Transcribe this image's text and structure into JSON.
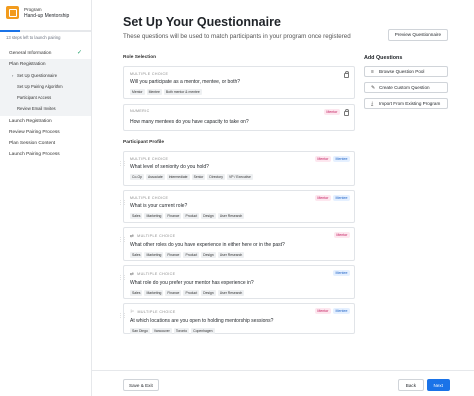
{
  "brand": {
    "program_label": "Program",
    "program_name": "Hand-up Mentorship"
  },
  "progress": {
    "fraction": 0.22,
    "steps_left": "13 steps left to launch pairing"
  },
  "sidebar": {
    "general_information": "General Information",
    "plan_registration": "Plan Registration",
    "sub_items": [
      "Set Up Questionnaire",
      "Set Up Pairing Algorithm",
      "Participant Access",
      "Review Email Invites"
    ],
    "launch_registration": "Launch Registration",
    "review_pairing_process": "Review Pairing Process",
    "plan_session_content": "Plan Session Content",
    "launch_pairing_process": "Launch Pairing Process"
  },
  "header": {
    "title": "Set Up Your Questionnaire",
    "subtitle": "These questions will be used to match participants in your program once registered",
    "preview_button": "Preview Questionnaire"
  },
  "role_selection": {
    "label": "Role Selection",
    "q1": {
      "type": "Multiple Choice",
      "question": "Will you participate as a mentor, mentee, or both?",
      "options": [
        "Mentor",
        "Mentee",
        "Both mentor & mentee"
      ]
    },
    "q2": {
      "type": "Numeric",
      "question": "How many mentees do you have capacity to take on?",
      "tags": [
        "Mentor"
      ]
    }
  },
  "participant_profile": {
    "label": "Participant Profile",
    "q1": {
      "type": "Multiple Choice",
      "question": "What level of seniority do you hold?",
      "tags": [
        "Mentor",
        "Mentee"
      ],
      "options": [
        "Co-Op",
        "Associate",
        "Intermediate",
        "Senior",
        "Directory",
        "VP / Executive"
      ]
    },
    "q2": {
      "type": "Multiple Choice",
      "question": "What is your current role?",
      "tags": [
        "Mentor",
        "Mentee"
      ],
      "options": [
        "Sales",
        "Marketing",
        "Finance",
        "Product",
        "Design",
        "User Research"
      ]
    },
    "q3": {
      "type": "Multiple Choice",
      "question": "What other roles do you have experience in either here or in the past?",
      "tags": [
        "Mentor"
      ],
      "options": [
        "Sales",
        "Marketing",
        "Finance",
        "Product",
        "Design",
        "User Research"
      ]
    },
    "q4": {
      "type": "Multiple Choice",
      "question": "What role do you prefer your mentor has experience in?",
      "tags": [
        "Mentee"
      ],
      "options": [
        "Sales",
        "Marketing",
        "Finance",
        "Product",
        "Design",
        "User Research"
      ]
    },
    "q5": {
      "type": "Multiple Choice",
      "question": "At which locations are you open to holding mentorship sessions?",
      "tags": [
        "Mentor",
        "Mentee"
      ],
      "options": [
        "San Diego",
        "Vancouver",
        "Toronto",
        "Copenhagen"
      ]
    }
  },
  "add_questions": {
    "title": "Add Questions",
    "browse": "Browse Question Pool",
    "create": "Create Custom Question",
    "import": "Import From Existing Program"
  },
  "footer": {
    "save_exit": "Save & Exit",
    "back": "Back",
    "next": "Next"
  },
  "colors": {
    "accent": "#1a73e8",
    "brand": "#f29b1d",
    "mentor_tag": "#c2185b",
    "mentee_tag": "#1a5fc4",
    "success": "#22a06b"
  }
}
